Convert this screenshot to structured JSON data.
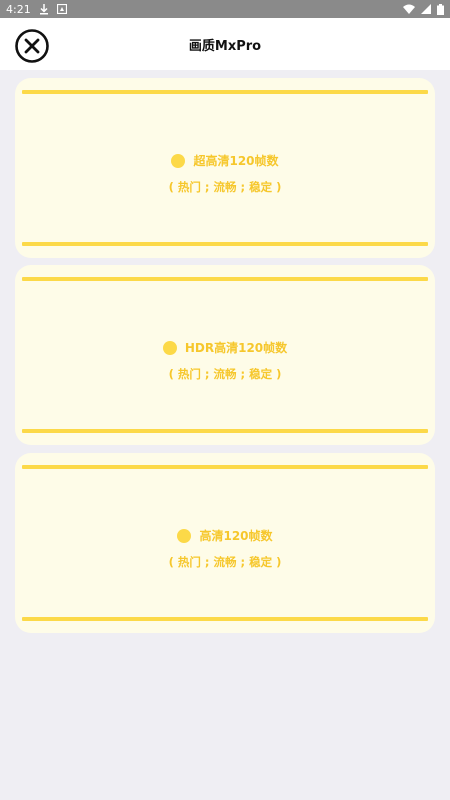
{
  "status_bar": {
    "time": "4:21",
    "icons": [
      "download-icon",
      "notification-icon",
      "wifi-icon",
      "signal-icon",
      "battery-icon"
    ]
  },
  "header": {
    "title": "画质MxPro",
    "close_icon": "close-icon"
  },
  "options": [
    {
      "title": "超高清120帧数",
      "subtitle": "( 热门 ; 流畅 ; 稳定 )"
    },
    {
      "title": "HDR高清120帧数",
      "subtitle": "( 热门 ; 流畅 ; 稳定 )"
    },
    {
      "title": "高清120帧数",
      "subtitle": "( 热门 ; 流畅 ; 稳定 )"
    }
  ],
  "colors": {
    "accent": "#fcd948",
    "text_accent": "#f6c72c",
    "card_bg": "#fefce8",
    "page_bg": "#efeef3",
    "status_bar_bg": "#8a8a8a"
  }
}
